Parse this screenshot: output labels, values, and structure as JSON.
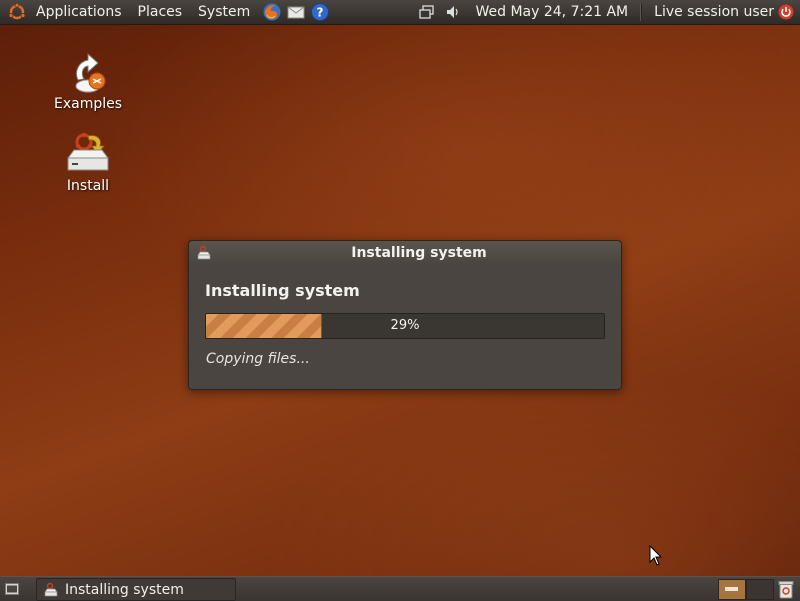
{
  "top_panel": {
    "menus": [
      "Applications",
      "Places",
      "System"
    ],
    "launchers": [
      "firefox-icon",
      "mail-icon",
      "help-icon"
    ],
    "clock": "Wed May 24,  7:21 AM",
    "user": "Live session user"
  },
  "desktop": {
    "icons": [
      {
        "label": "Examples",
        "icon": "examples-icon"
      },
      {
        "label": "Install",
        "icon": "install-icon"
      }
    ]
  },
  "dialog": {
    "title": "Installing system",
    "heading": "Installing system",
    "progress": 0.29,
    "progress_text": "29%",
    "status": "Copying files..."
  },
  "bottom_panel": {
    "task": "Installing system",
    "workspaces": 2
  },
  "colors": {
    "panel": "#3a3530",
    "progress_fill": "#e29b5d",
    "wallpaper": "#7a2e0e"
  }
}
